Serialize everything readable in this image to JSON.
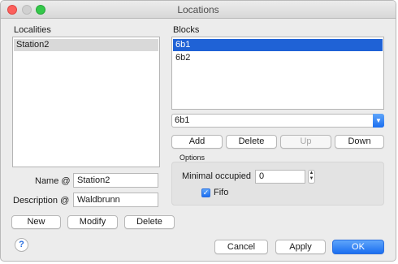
{
  "window": {
    "title": "Locations"
  },
  "localities": {
    "label": "Localities",
    "items": [
      "Station2"
    ]
  },
  "blocks": {
    "label": "Blocks",
    "items": [
      "6b1",
      "6b2"
    ],
    "combo_value": "6b1",
    "buttons": {
      "add": "Add",
      "delete": "Delete",
      "up": "Up",
      "down": "Down"
    }
  },
  "form": {
    "name_label": "Name @",
    "name_value": "Station2",
    "description_label": "Description @",
    "description_value": "Waldbrunn"
  },
  "locality_buttons": {
    "new": "New",
    "modify": "Modify",
    "delete": "Delete"
  },
  "options": {
    "label": "Options",
    "minimal_occupied_label": "Minimal occupied",
    "minimal_occupied_value": "0",
    "fifo_label": "Fifo",
    "fifo_checked": true
  },
  "footer": {
    "help": "?",
    "cancel": "Cancel",
    "apply": "Apply",
    "ok": "OK"
  }
}
